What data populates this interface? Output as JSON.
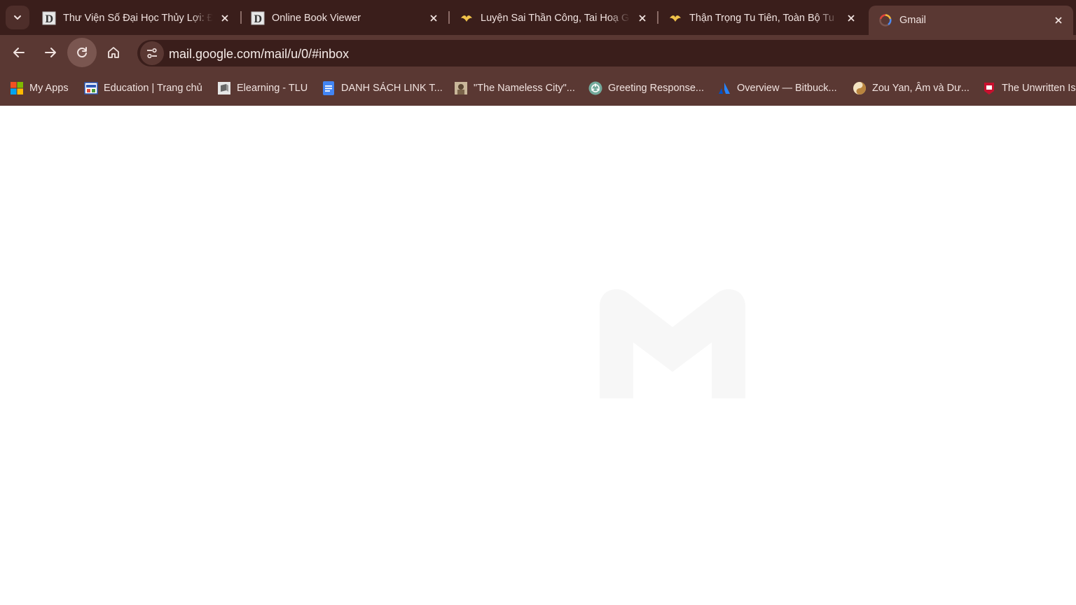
{
  "tabs": [
    {
      "title": "Thư Viện Số Đại Học Thủy Lợi: Đ",
      "icon": "letter-d-icon",
      "active": false
    },
    {
      "title": "Online Book Viewer",
      "icon": "letter-d-icon",
      "active": false
    },
    {
      "title": "Luyện Sai Thần Công, Tai Hoạ G",
      "icon": "wing-logo-icon",
      "active": false
    },
    {
      "title": "Thận Trọng Tu Tiên, Toàn Bộ Tu",
      "icon": "wing-logo-icon",
      "active": false
    },
    {
      "title": "Gmail",
      "icon": "loading-spinner-icon",
      "active": true
    }
  ],
  "address_bar": {
    "url": "mail.google.com/mail/u/0/#inbox"
  },
  "bookmarks": [
    {
      "label": "My Apps",
      "icon": "windows-logo-icon"
    },
    {
      "label": "Education | Trang chủ",
      "icon": "education-site-icon"
    },
    {
      "label": "Elearning - TLU",
      "icon": "elearning-icon"
    },
    {
      "label": "DANH SÁCH LINK T...",
      "icon": "google-docs-icon"
    },
    {
      "label": "\"The Nameless City\"...",
      "icon": "portrait-icon"
    },
    {
      "label": "Greeting Response...",
      "icon": "chatgpt-icon"
    },
    {
      "label": "Overview — Bitbuck...",
      "icon": "atlassian-icon"
    },
    {
      "label": "Zou Yan, Âm và Dư...",
      "icon": "yin-yang-icon"
    },
    {
      "label": "The Unwritten Is",
      "icon": "red-badge-icon"
    }
  ],
  "colors": {
    "tabstrip_bg": "#3a1e1b",
    "toolbar_bg": "#5a3833",
    "omnibox_bg": "#3a1e1b",
    "text": "#f1e3e0",
    "content_bg": "#ffffff",
    "logo_placeholder": "#f7f7f7"
  }
}
